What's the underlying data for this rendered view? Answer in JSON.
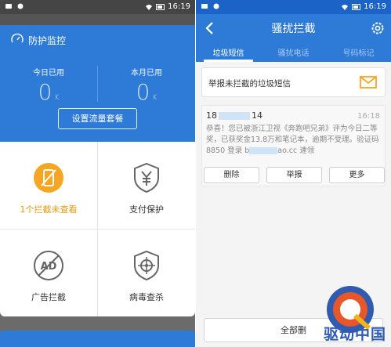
{
  "status_bar": {
    "time": "16:19"
  },
  "left": {
    "card_title": "防护监控",
    "today_label": "今日已用",
    "today_value": "0",
    "today_unit": "K",
    "month_label": "本月已用",
    "month_value": "0",
    "month_unit": "K",
    "setup_button": "设置流量套餐",
    "tiles": [
      {
        "label": "1个拦截未查看",
        "icon": "blocked-phone-icon",
        "color": "#f5a623"
      },
      {
        "label": "支付保护",
        "icon": "yuan-shield-icon"
      },
      {
        "label": "广告拦截",
        "icon": "ad-block-icon"
      },
      {
        "label": "病毒查杀",
        "icon": "crosshair-shield-icon"
      }
    ]
  },
  "right": {
    "title": "骚扰拦截",
    "tabs": [
      "垃圾短信",
      "骚扰电话",
      "号码标记"
    ],
    "active_tab": 0,
    "report_text": "举报未拦截的垃圾短信",
    "message": {
      "sender_prefix": "18",
      "sender_suffix": "14",
      "time": "16:18",
      "body_1": "恭喜！您已被浙江卫视《奔跑吧兄弟》评为今日二等奖，已获奖金13.8万和笔记本，逾期不受理。验证码8850 登录 b",
      "body_2": "ao.cc 速领"
    },
    "actions": [
      "删除",
      "举报",
      "更多"
    ],
    "bottom_button": "全部删"
  },
  "watermark": "驱动中国",
  "colors": {
    "brand_blue": "#2d7ad7",
    "warn_orange": "#f5a623"
  }
}
